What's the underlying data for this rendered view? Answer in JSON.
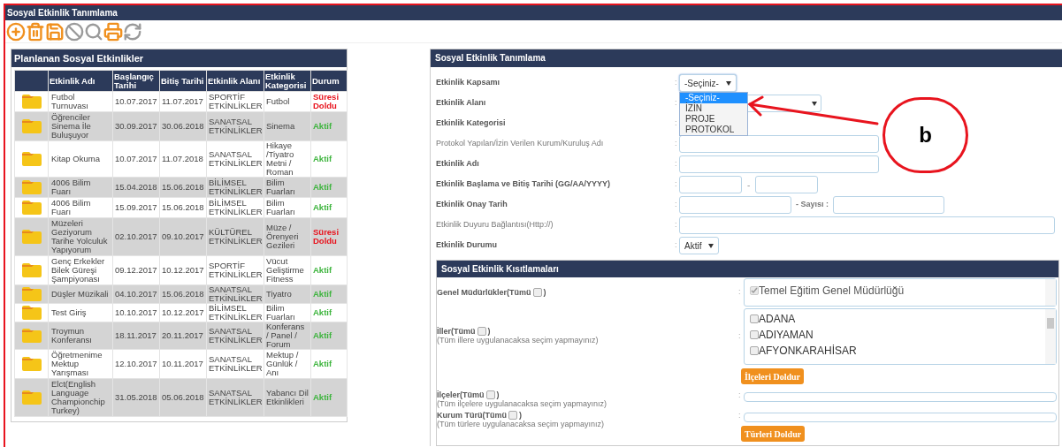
{
  "window": {
    "title": "Sosyal Etkinlik Tanımlama"
  },
  "toolbar": [
    {
      "kind": "add"
    },
    {
      "kind": "delete"
    },
    {
      "kind": "save"
    },
    {
      "kind": "cancel"
    },
    {
      "kind": "search"
    },
    {
      "kind": "print"
    },
    {
      "kind": "refresh"
    }
  ],
  "list_panel": {
    "title": "Planlanan Sosyal Etkinlikler",
    "columns": [
      "",
      "Etkinlik Adı",
      "Başlangıç Tarihi",
      "Bitiş Tarihi",
      "Etkinlik Alanı",
      "Etkinlik Kategorisi",
      "Durum"
    ],
    "rows": [
      {
        "name": "Futbol Turnuvası",
        "start": "10.07.2017",
        "end": "11.07.2017",
        "area": "SPORTİF ETKİNLİKLER",
        "category": "Futbol",
        "status": "Süresi Doldu",
        "kind": "expired"
      },
      {
        "name": "Öğrenciler Sinema İle Buluşuyor",
        "start": "30.09.2017",
        "end": "30.06.2018",
        "area": "SANATSAL ETKİNLİKLER",
        "category": "Sinema",
        "status": "Aktif",
        "kind": "active"
      },
      {
        "name": "Kitap Okuma",
        "start": "10.07.2017",
        "end": "11.07.2018",
        "area": "SANATSAL ETKİNLİKLER",
        "category": "Hikaye /Tiyatro Metni / Roman",
        "status": "Aktif",
        "kind": "active"
      },
      {
        "name": "4006 Bilim Fuarı",
        "start": "15.04.2018",
        "end": "15.06.2018",
        "area": "BİLİMSEL ETKİNLİKLER",
        "category": "Bilim Fuarları",
        "status": "Aktif",
        "kind": "active"
      },
      {
        "name": "4006 Bilim Fuarı",
        "start": "15.09.2017",
        "end": "15.06.2018",
        "area": "BİLİMSEL ETKİNLİKLER",
        "category": "Bilim Fuarları",
        "status": "Aktif",
        "kind": "active"
      },
      {
        "name": "Müzeleri Geziyorum Tarihe Yolculuk Yapıyorum",
        "start": "02.10.2017",
        "end": "09.10.2017",
        "area": "KÜLTÜREL ETKİNLİKLER",
        "category": "Müze / Örenyeri Gezileri",
        "status": "Süresi Doldu",
        "kind": "expired"
      },
      {
        "name": "Genç Erkekler Bilek Güreşi Şampiyonası",
        "start": "09.12.2017",
        "end": "10.12.2017",
        "area": "SPORTİF ETKİNLİKLER",
        "category": "Vücut Geliştirme Fitness",
        "status": "Aktif",
        "kind": "active"
      },
      {
        "name": "Düşler Müzikali",
        "start": "04.10.2017",
        "end": "15.06.2018",
        "area": "SANATSAL ETKİNLİKLER",
        "category": "Tiyatro",
        "status": "Aktif",
        "kind": "active"
      },
      {
        "name": "Test Giriş",
        "start": "10.10.2017",
        "end": "10.12.2017",
        "area": "BİLİMSEL ETKİNLİKLER",
        "category": "Bilim Fuarları",
        "status": "Aktif",
        "kind": "active"
      },
      {
        "name": "Troymun Konferansı",
        "start": "18.11.2017",
        "end": "20.11.2017",
        "area": "SANATSAL ETKİNLİKLER",
        "category": "Konferans / Panel / Forum",
        "status": "Aktif",
        "kind": "active"
      },
      {
        "name": "Öğretmenime Mektup Yarışması",
        "start": "12.10.2017",
        "end": "10.11.2017",
        "area": "SANATSAL ETKİNLİKLER",
        "category": "Mektup / Günlük / Anı",
        "status": "Aktif",
        "kind": "active"
      },
      {
        "name": "Elct(English Language Championchip Turkey)",
        "start": "31.05.2018",
        "end": "05.06.2018",
        "area": "SANATSAL ETKİNLİKLER",
        "category": "Yabancı Dil Etkinlikleri",
        "status": "Aktif",
        "kind": "active"
      }
    ]
  },
  "form_panel": {
    "title": "Sosyal Etkinlik Tanımlama",
    "fields": [
      {
        "label": "Etkinlik Kapsamı",
        "bold": true,
        "separator": ":",
        "kind": "select",
        "value": "-Seçiniz-",
        "expanded": true,
        "options": [
          {
            "label": "-Seçiniz-",
            "selected": true
          },
          {
            "label": "İZİN",
            "selected": false
          },
          {
            "label": "PROJE",
            "selected": false
          },
          {
            "label": "PROTOKOL",
            "selected": false
          }
        ]
      },
      {
        "label": "Etkinlik Alanı",
        "bold": true,
        "separator": ":",
        "kind": "select_wide"
      },
      {
        "label": "Etkinlik Kategorisi",
        "bold": true,
        "separator": ":",
        "kind": "hidden"
      },
      {
        "label": "Protokol Yapılan/İzin Verilen Kurum/Kuruluş Adı",
        "bold": false,
        "separator": ":",
        "kind": "text"
      },
      {
        "label": "Etkinlik Adı",
        "bold": true,
        "separator": ":",
        "kind": "text"
      },
      {
        "label": "Etkinlik Başlama ve Bitiş Tarihi (GG/AA/YYYY)",
        "bold": true,
        "separator": ":",
        "kind": "date_range",
        "dash": "-"
      },
      {
        "label": "Etkinlik Onay Tarih",
        "bold": true,
        "separator": ":",
        "kind": "approval",
        "extra_label": "- Sayısı :"
      },
      {
        "label": "Etkinlik Duyuru Bağlantısı(Http://)",
        "bold": false,
        "separator": ":",
        "kind": "url"
      },
      {
        "label": "Etkinlik Durumu",
        "bold": true,
        "separator": ":",
        "kind": "select",
        "value": "Aktif",
        "expanded": false
      }
    ]
  },
  "restrictions": {
    "title": "Sosyal Etkinlik Kısıtlamaları",
    "groups": [
      {
        "label": "Genel Müdürlükler(Tümü",
        "label_end": ")",
        "all_checked": false,
        "separator": ":",
        "kind": "list",
        "items": [
          {
            "label": "Temel Eğitim Genel Müdürlüğü",
            "checked": true,
            "disabled": true
          }
        ]
      },
      {
        "label": "İller(Tümü",
        "label_end": ")",
        "all_checked": false,
        "hint": "(Tüm illere uygulanacaksa seçim yapmayınız)",
        "separator": ":",
        "kind": "list",
        "items": [
          {
            "label": "ADANA",
            "checked": false,
            "disabled": false
          },
          {
            "label": "ADIYAMAN",
            "checked": false,
            "disabled": false
          },
          {
            "label": "AFYONKARAHİSAR",
            "checked": false,
            "disabled": false
          }
        ],
        "button": "İlçeleri Doldur"
      },
      {
        "label": "İlçeler(Tümü",
        "label_end": ")",
        "all_checked": false,
        "hint": "(Tüm ilçelere uygulanacaksa seçim yapmayınız)",
        "separator": ":",
        "kind": "empty"
      },
      {
        "label": "Kurum Türü(Tümü",
        "label_end": ")",
        "all_checked": false,
        "hint": "(Tüm türlere uygulanacaksa seçim yapmayınız)",
        "separator": ":",
        "kind": "empty",
        "button": "Türleri Doldur"
      }
    ]
  },
  "annotation": {
    "label": "b"
  }
}
